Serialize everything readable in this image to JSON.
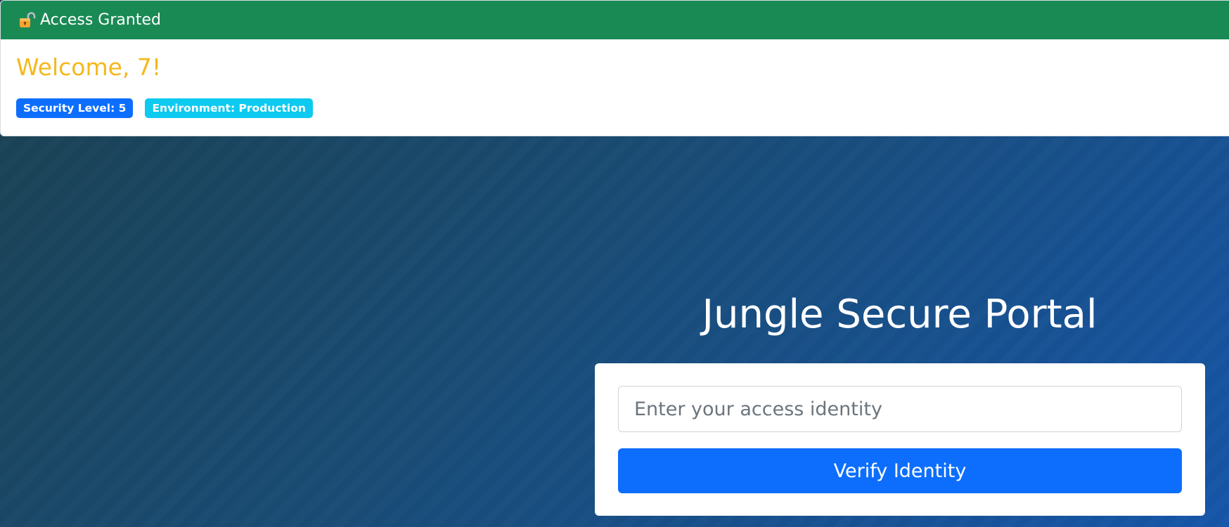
{
  "access": {
    "header_icon": "unlocked-padlock-icon",
    "header_title": "Access Granted",
    "welcome_text": "Welcome, 7!",
    "badges": [
      {
        "label": "Security Level: 5",
        "color": "#0d6efd"
      },
      {
        "label": "Environment: Production",
        "color": "#0dcaf0"
      }
    ],
    "header_color": "#1a8a55",
    "welcome_color": "#f5b81d"
  },
  "portal": {
    "title": "Jungle Secure Portal",
    "input_placeholder": "Enter your access identity",
    "input_value": "",
    "button_label": "Verify Identity",
    "button_color": "#0d6efd"
  }
}
